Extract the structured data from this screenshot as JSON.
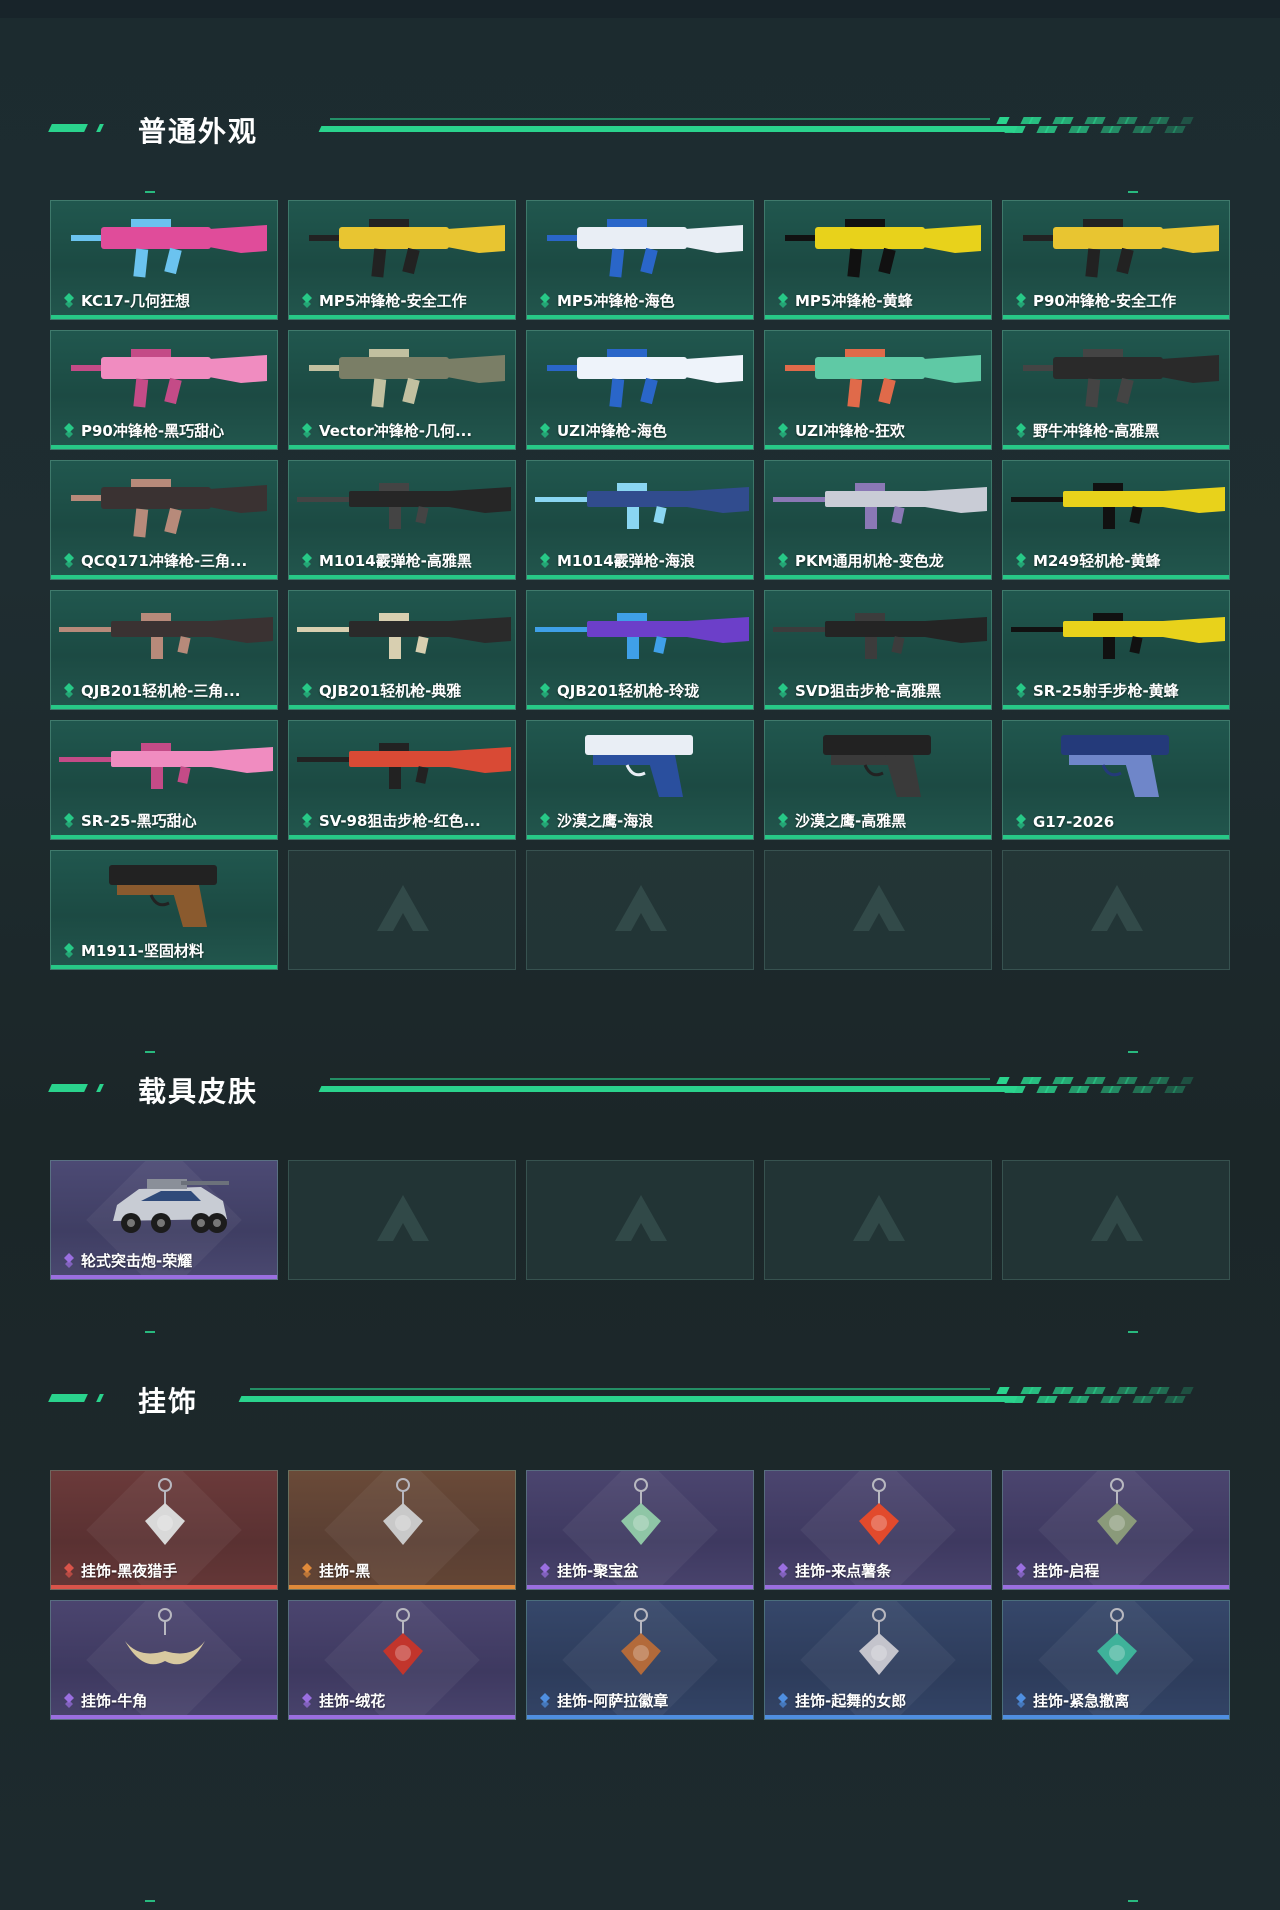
{
  "sections": {
    "weapons": {
      "title": "普通外观",
      "items": [
        {
          "name": "KC17-几何狂想"
        },
        {
          "name": "MP5冲锋枪-安全工作"
        },
        {
          "name": "MP5冲锋枪-海色"
        },
        {
          "name": "MP5冲锋枪-黄蜂"
        },
        {
          "name": "P90冲锋枪-安全工作"
        },
        {
          "name": "P90冲锋枪-黑巧甜心"
        },
        {
          "name": "Vector冲锋枪-几何..."
        },
        {
          "name": "UZI冲锋枪-海色"
        },
        {
          "name": "UZI冲锋枪-狂欢"
        },
        {
          "name": "野牛冲锋枪-高雅黑"
        },
        {
          "name": "QCQ171冲锋枪-三角..."
        },
        {
          "name": "M1014霰弹枪-高雅黑"
        },
        {
          "name": "M1014霰弹枪-海浪"
        },
        {
          "name": "PKM通用机枪-变色龙"
        },
        {
          "name": "M249轻机枪-黄蜂"
        },
        {
          "name": "QJB201轻机枪-三角..."
        },
        {
          "name": "QJB201轻机枪-典雅"
        },
        {
          "name": "QJB201轻机枪-玲珑"
        },
        {
          "name": "SVD狙击步枪-高雅黑"
        },
        {
          "name": "SR-25射手步枪-黄蜂"
        },
        {
          "name": "SR-25-黑巧甜心"
        },
        {
          "name": "SV-98狙击步枪-红色..."
        },
        {
          "name": "沙漠之鹰-海浪"
        },
        {
          "name": "沙漠之鹰-高雅黑"
        },
        {
          "name": "G17-2026"
        },
        {
          "name": "M1911-坚固材料"
        }
      ]
    },
    "vehicles": {
      "title": "载具皮肤",
      "items": [
        {
          "name": "轮式突击炮-荣耀"
        }
      ]
    },
    "pendants": {
      "title": "挂饰",
      "items": [
        {
          "name": "挂饰-黑夜猎手",
          "rarity": "red"
        },
        {
          "name": "挂饰-黑",
          "rarity": "orange"
        },
        {
          "name": "挂饰-聚宝盆",
          "rarity": "purple"
        },
        {
          "name": "挂饰-来点薯条",
          "rarity": "purple"
        },
        {
          "name": "挂饰-启程",
          "rarity": "purple"
        },
        {
          "name": "挂饰-牛角",
          "rarity": "purple"
        },
        {
          "name": "挂饰-绒花",
          "rarity": "purple"
        },
        {
          "name": "挂饰-阿萨拉徽章",
          "rarity": "blue"
        },
        {
          "name": "挂饰-起舞的女郎",
          "rarity": "blue"
        },
        {
          "name": "挂饰-紧急撤离",
          "rarity": "blue"
        }
      ]
    }
  },
  "colors": {
    "accent": "#2ad38d",
    "weapon_card_bar": "#27c987",
    "rarity_red": "#d9544a",
    "rarity_orange": "#e08a3a",
    "rarity_purple": "#9a6fe0",
    "rarity_blue": "#4f8fe0"
  },
  "icons": {
    "rarity": "diamond-stack-icon",
    "empty_slot": "triangle-logo-icon"
  }
}
